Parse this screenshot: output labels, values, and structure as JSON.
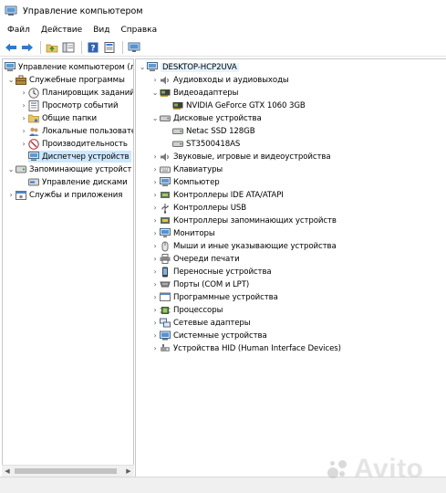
{
  "window": {
    "title": "Управление компьютером"
  },
  "menu": [
    "Файл",
    "Действие",
    "Вид",
    "Справка"
  ],
  "toolbar": {
    "icons": [
      "back-arrow-icon",
      "forward-arrow-icon",
      "up-folder-icon",
      "show-hide-tree-icon",
      "help-icon",
      "properties-icon",
      "monitor-icon"
    ]
  },
  "left_tree": {
    "root": "Управление компьютером (л",
    "system_tools": "Служебные программы",
    "task_scheduler": "Планировщик заданий",
    "event_viewer": "Просмотр событий",
    "shared_folders": "Общие папки",
    "local_users": "Локальные пользовате",
    "performance": "Производительность",
    "device_manager": "Диспетчер устройств",
    "storage": "Запоминающие устройст",
    "disk_management": "Управление дисками",
    "services": "Службы и приложения"
  },
  "right_tree": {
    "root": "DESKTOP-HCP2UVA",
    "audio_io": "Аудиовходы и аудиовыходы",
    "video_adapters": "Видеоадаптеры",
    "gpu": "NVIDIA GeForce GTX 1060 3GB",
    "disk_devices": "Дисковые устройства",
    "ssd": "Netac SSD 128GB",
    "hdd": "ST3500418AS",
    "sound": "Звуковые, игровые и видеоустройства",
    "keyboards": "Клавиатуры",
    "computer": "Компьютер",
    "ide": "Контроллеры IDE ATA/ATAPI",
    "usb": "Контроллеры USB",
    "storage_ctrl": "Контроллеры запоминающих устройств",
    "monitors": "Мониторы",
    "mice": "Мыши и иные указывающие устройства",
    "print_queues": "Очереди печати",
    "portable": "Переносные устройства",
    "ports": "Порты (COM и LPT)",
    "software": "Программные устройства",
    "processors": "Процессоры",
    "network": "Сетевые адаптеры",
    "system": "Системные устройства",
    "hid": "Устройства HID (Human Interface Devices)"
  },
  "watermark": {
    "text": "Avito"
  },
  "colors": {
    "selection": "#cce8ff",
    "hover": "#e5f3ff",
    "pane_border": "#c9c9c9"
  }
}
